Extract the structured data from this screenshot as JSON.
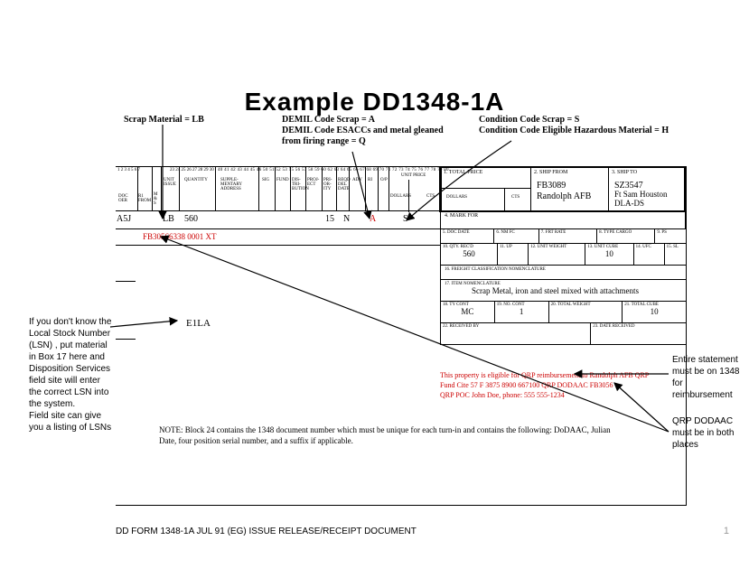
{
  "title": "Example DD1348-1A",
  "callouts": {
    "scrap_material": "Scrap Material = LB",
    "demil_code": "DEMIL Code Scrap  = A\nDEMIL Code ESACCs and metal gleaned\nfrom firing range = Q",
    "condition_code": "Condition Code Scrap = S\nCondition Code Eligible Hazardous Material = H"
  },
  "header_nums_left": "1  2  3  4  5  6  7",
  "header_nums_mid": "23 24 25 26 27 28 29 30",
  "header_nums_r": "40 41 42 43 44 45 46 50 51 52 53 55 56 57 58 59 60     62 63 64 65 66 67 68 69 70 71 72 73 74 75 76 77 78 79 80",
  "cols_left": {
    "doc_oer": "DOC\nOER",
    "ri": "R1\nFROM",
    "ms": "M\n&\nS"
  },
  "cols_mid": {
    "ui": "UNIT\nISSUE",
    "qty": "QUANTITY",
    "suppl": "SUPPLE-\nMENTARY\nADDRESS",
    "sig": "SIG",
    "fund": "FUND",
    "dis": "DIS-\nTRI-\nBUTION",
    "proj": "PROJ-\nECT",
    "pri": "PRI-\nOR-\nITY",
    "reqd": "REQD\nDEL\nDATE",
    "adv": "ADV",
    "ri2": "RI",
    "op": "O/P"
  },
  "unit_price_lbl": "UNIT PRICE",
  "total_price_lbl": "1. TOTAL PRICE",
  "dollars": "DOLLARS",
  "cts": "CTS",
  "ship_from": {
    "lbl": "2. SHIP FROM",
    "code": "FB3089",
    "base": "Randolph AFB"
  },
  "ship_to": {
    "lbl": "3. SHIP TO",
    "code": "SZ3547",
    "base": "Ft Sam Houston",
    "extra": "DLA-DS"
  },
  "mark_for_lbl": "4. MARK FOR",
  "vals": {
    "a5j": "A5J",
    "lb": "LB",
    "qty": "560",
    "fifteen": "15",
    "n": "N",
    "a": "A",
    "s": "S"
  },
  "doc_num": "FB30566338 0001 XT",
  "e1la": "E1LA",
  "rb": {
    "r1": [
      "5. DOC DATE",
      "6. NM FC",
      "7. FRT RATE",
      "8. TYPE CARGO",
      "9. PS"
    ],
    "r2_lbls": [
      "10. QTY. REC'D",
      "11. UP",
      "12. UNIT WEIGHT",
      "13. UNIT CUBE",
      "14. UFC",
      "15. SL"
    ],
    "r2_vals": [
      "560",
      "",
      "",
      "10",
      "",
      ""
    ],
    "r3": "16. FREIGHT CLASSIFICATION NOMENCLATURE",
    "r4_lbl": "17. ITEM NOMENCLATURE",
    "r4_txt": "Scrap Metal, iron and steel mixed with attachments",
    "r5_lbls": [
      "18. TY CONT",
      "19. NO. CONT",
      "20. TOTAL WEIGHT",
      "21. TOTAL CUBE"
    ],
    "r5_vals": [
      "MC",
      "1",
      "",
      "10"
    ],
    "r6_lbls": [
      "22. RECEIVED BY",
      "23. DATE RECEIVED"
    ]
  },
  "red_stmt": {
    "l1": "This property is eligible for QRP reimbursement to Randolph AFB QRP",
    "l2": "Fund Cite 57 F 3875 8900 667100                QRP DODAAC FB3056",
    "l3": "QRP POC John Doe, phone: 555 555-1234"
  },
  "note": "NOTE: Block 24 contains the 1348 document number which must be unique for each turn-in and contains the following:  DoDAAC, Julian Date, four position serial number, and a suffix if applicable.",
  "side_left": "If you don't know the Local Stock Number (LSN) , put material in Box 17 here and Disposition Services field site will enter the correct LSN into the system.\nField site can give you a listing of LSNs",
  "side_right_1": "Entire statement must be on 1348 for reimbursement",
  "side_right_2": "QRP DODAAC must be in both places",
  "footer": "DD FORM 1348-1A JUL 91 (EG) ISSUE RELEASE/RECEIPT DOCUMENT",
  "page_num": "1"
}
